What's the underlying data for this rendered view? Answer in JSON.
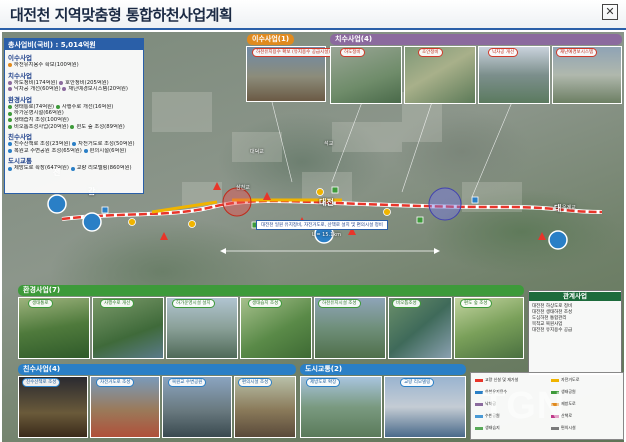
{
  "title": "대전천 지역맞춤형 통합하천사업계획",
  "budget": {
    "header": "총사업비(국비) : 5,014억원",
    "categories": [
      {
        "name": "이수사업",
        "items": [
          "하천유지용수 확보(100억원)"
        ]
      },
      {
        "name": "치수사업",
        "items": [
          "하도정비(174억원)",
          "호안정비(205억원)",
          "낙차공 개선(60억원)",
          "재난예경보시스템(20억원)"
        ]
      },
      {
        "name": "환경사업",
        "items": [
          "생태통로(74억원)",
          "사행수로 개선(16억원)",
          "하가운영시설(66억원)",
          "생태습지 조성(100억원)",
          "비오톱조성사업(20억원)",
          "편도 숲 조성(89억원)"
        ]
      },
      {
        "name": "친수사업",
        "items": [
          "친수산책로 조성(23억원)",
          "자전거도로 조성(50억원)",
          "복원교 수변공원 조성(65억원)",
          "편의시설(6억원)"
        ]
      },
      {
        "name": "도시교통",
        "items": [
          "제방도로 확장(647억원)",
          "교량 리모델링(860억원)"
        ]
      }
    ]
  },
  "sections": {
    "isu": "이수사업(1)",
    "chisu": "치수사업(4)",
    "hwangyeong": "환경사업(7)",
    "chinsu": "친수사업(4)",
    "dosi": "도시교통(2)"
  },
  "top_captions": {
    "isu_1": "하천유지용수 확보 (유지용수 공급시설)",
    "chisu_1": "하도정비",
    "chisu_2": "호안정비",
    "chisu_3": "낙차공 개선",
    "chisu_4": "재난예경보시스템"
  },
  "bottom_captions": {
    "env_1": "생태통로",
    "env_2": "사행수로 개선",
    "env_3": "하가운영시설 설치",
    "env_4": "생태습지 조성",
    "env_5": "하천유지시설 조성",
    "env_6": "비오톱조성",
    "env_7": "편도 숲 조성",
    "chin_1": "친수산책로 조성",
    "chin_2": "자전거도로 조성",
    "chin_3": "복원교 수변공원",
    "chin_4": "편의시설 조성",
    "dosi_1": "제방도로 확장",
    "dosi_2": "교량 리모델링"
  },
  "scale_note": "대전천 일원 유지정비, 자전거도로, 산책로 설치 및 편의시설 정비",
  "length": "L = 15.1km",
  "places": {
    "daedeok": "대덕교",
    "seokgyo": "석교",
    "daejeon": "대전",
    "cheon": "천",
    "gap": "갑",
    "dae": "대",
    "samcheon": "삼천교",
    "okgye": "옥계교"
  },
  "legend": {
    "title": "관계사업",
    "items": [
      "대전천 하상도로 정비",
      "대전천 생태하천 조성",
      "도심하천 통합관리",
      "목척교 복원사업",
      "대전천 유지용수 공급"
    ]
  },
  "legend_box": [
    "교량 신설 및 재가설",
    "자전거도로",
    "하천유지용수",
    "생태공원",
    "낙차공",
    "제방도로",
    "수변공원",
    "산책로",
    "생태습지",
    "편의시설"
  ],
  "watermark": "TGN",
  "colors": {
    "isu": "#e08a1e",
    "chisu": "#8b6a9e",
    "hwangyeong": "#3d9a3a",
    "chinsu": "#2a7fc6",
    "dosi": "#2a7fc6",
    "river": "#e8352a",
    "title_rule": "#2a5fa8"
  }
}
